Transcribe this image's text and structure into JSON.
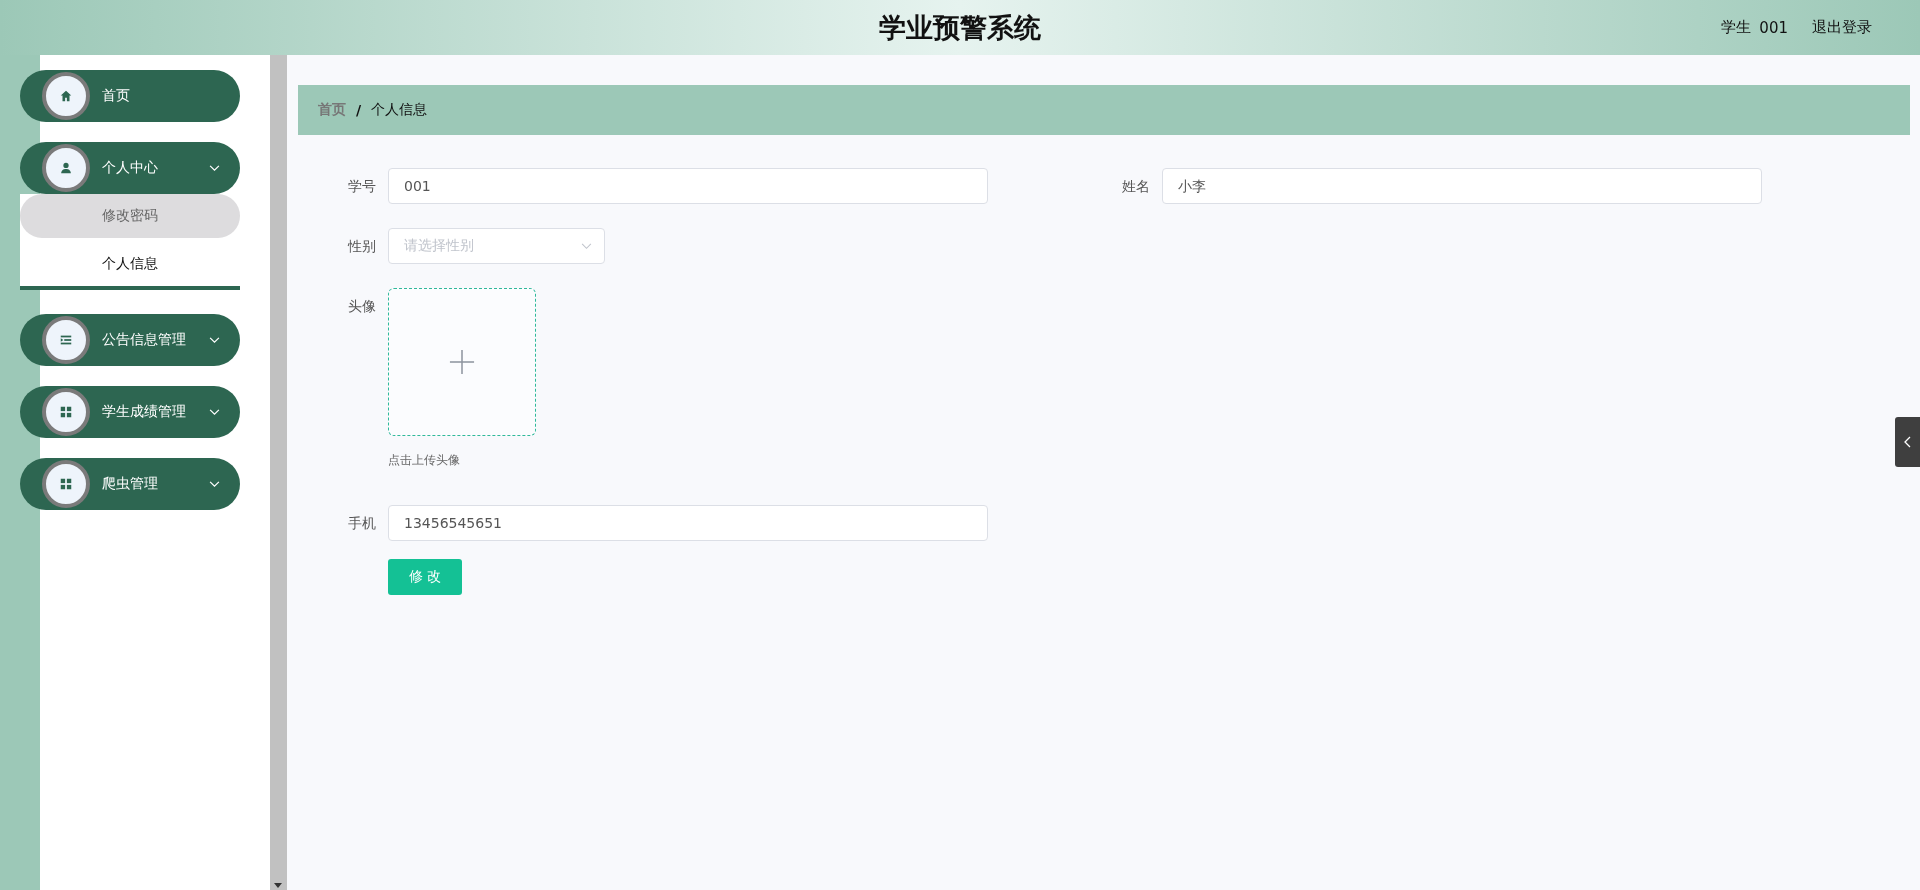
{
  "header": {
    "title": "学业预警系统",
    "user_role": "学生",
    "user_name": "001",
    "logout": "退出登录"
  },
  "menu": [
    {
      "kind": "home",
      "label": "首页",
      "has_submenu": false
    },
    {
      "kind": "user",
      "label": "个人中心",
      "has_submenu": true,
      "children": [
        {
          "label": "修改密码",
          "hovered": true,
          "selected": false
        },
        {
          "label": "个人信息",
          "hovered": false,
          "selected": true
        }
      ]
    },
    {
      "kind": "list",
      "label": "公告信息管理",
      "has_submenu": true
    },
    {
      "kind": "grid",
      "label": "学生成绩管理",
      "has_submenu": true
    },
    {
      "kind": "grid",
      "label": "爬虫管理",
      "has_submenu": true
    }
  ],
  "breadcrumb": {
    "separator": "/",
    "items": [
      "首页",
      "个人信息"
    ]
  },
  "form": {
    "rows": [
      [
        {
          "kind": "text",
          "label": "学号",
          "value": "001"
        },
        {
          "kind": "text",
          "label": "姓名",
          "value": "小李"
        }
      ],
      [
        {
          "kind": "select",
          "label": "性别",
          "placeholder": "请选择性别"
        }
      ],
      [
        {
          "kind": "upload",
          "label": "头像",
          "hint": "点击上传头像"
        }
      ],
      [
        {
          "kind": "text",
          "label": "手机",
          "value": "13456545651"
        }
      ]
    ],
    "submit": "修 改"
  }
}
